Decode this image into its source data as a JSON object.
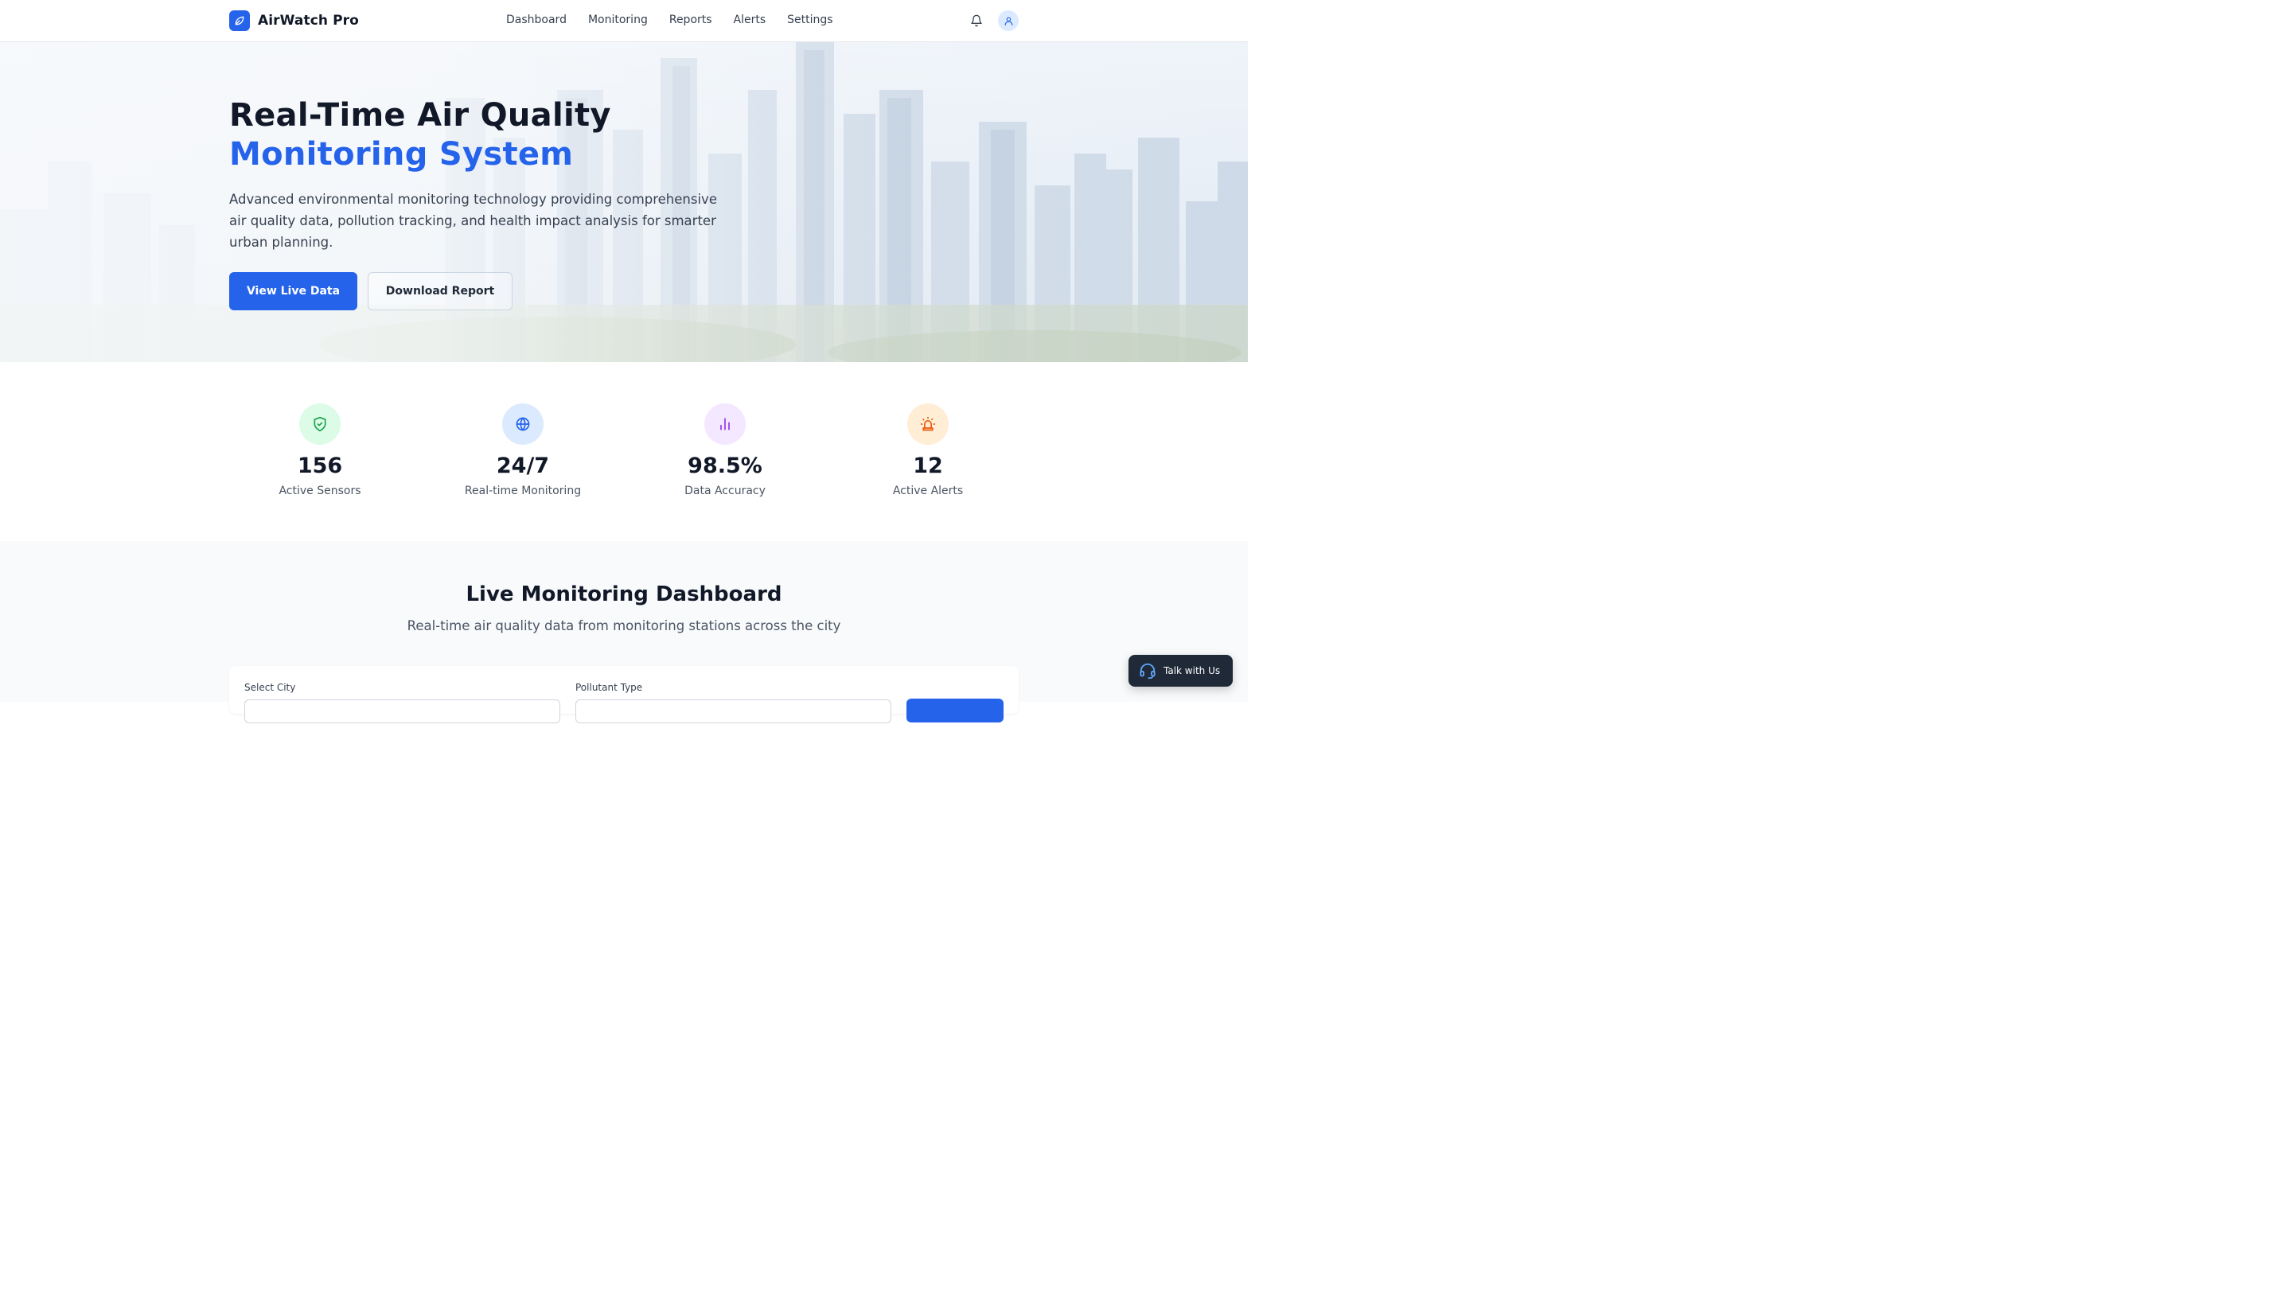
{
  "brand": {
    "name": "AirWatch Pro",
    "logo_icon": "leaf-icon",
    "color": "#2563eb"
  },
  "nav": {
    "links": [
      "Dashboard",
      "Monitoring",
      "Reports",
      "Alerts",
      "Settings"
    ],
    "notification_icon": "bell-icon",
    "user_icon": "user-icon"
  },
  "hero": {
    "title_line1": "Real-Time Air Quality",
    "title_line2": "Monitoring System",
    "description": "Advanced environmental monitoring technology providing comprehensive air quality data, pollution tracking, and health impact analysis for smarter urban planning.",
    "primary_button": "View Live Data",
    "secondary_button": "Download Report"
  },
  "stats": [
    {
      "value": "156",
      "label": "Active Sensors",
      "icon": "shield-check-icon",
      "color": "#16a34a",
      "bg": "#dcfce7"
    },
    {
      "value": "24/7",
      "label": "Real-time Monitoring",
      "icon": "globe-icon",
      "color": "#2563eb",
      "bg": "#dbeafe"
    },
    {
      "value": "98.5%",
      "label": "Data Accuracy",
      "icon": "bar-chart-icon",
      "color": "#9333ea",
      "bg": "#f3e8ff"
    },
    {
      "value": "12",
      "label": "Active Alerts",
      "icon": "siren-icon",
      "color": "#ea580c",
      "bg": "#ffedd5"
    }
  ],
  "dashboard": {
    "title": "Live Monitoring Dashboard",
    "subtitle": "Real-time air quality data from monitoring stations across the city",
    "filters": {
      "city_label": "Select City",
      "pollutant_label": "Pollutant Type"
    }
  },
  "chat": {
    "label": "Talk with Us",
    "icon": "headset-icon"
  }
}
